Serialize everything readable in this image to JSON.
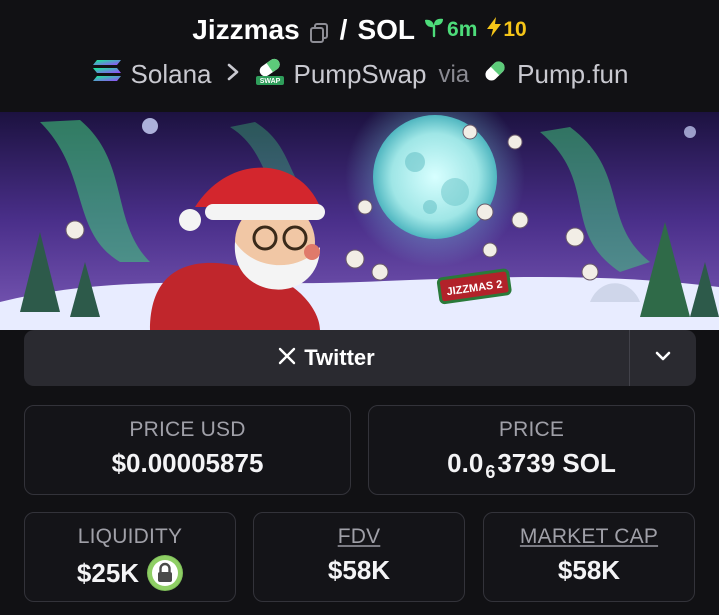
{
  "header": {
    "token_symbol": "Jizzmas",
    "quote_symbol": "SOL",
    "slash": "/",
    "age": "6m",
    "boosts": "10",
    "chain": "Solana",
    "dex": "PumpSwap",
    "via_text": "via",
    "launchpad": "Pump.fun"
  },
  "banner": {
    "sign_text": "JIZZMAS 2"
  },
  "social": {
    "twitter_label": "Twitter"
  },
  "stats": {
    "price_usd_label": "PRICE USD",
    "price_usd_value": "$0.00005875",
    "price_label": "PRICE",
    "price_prefix": "0.0",
    "price_zeros": "6",
    "price_suffix": "3739 SOL",
    "liquidity_label": "LIQUIDITY",
    "liquidity_value": "$25K",
    "fdv_label": "FDV",
    "fdv_value": "$58K",
    "mcap_label": "MARKET CAP",
    "mcap_value": "$58K"
  },
  "colors": {
    "background": "#111114",
    "age_green": "#4ddc7a",
    "boost_yellow": "#f5c518",
    "lock_green": "#7fbf5a",
    "card_border": "#33333a"
  },
  "icons": [
    "copy-icon",
    "seedling-icon",
    "lightning-icon",
    "solana-icon",
    "chevron-right-icon",
    "pumpswap-icon",
    "pill-icon",
    "x-logo-icon",
    "chevron-down-icon",
    "lock-icon"
  ]
}
